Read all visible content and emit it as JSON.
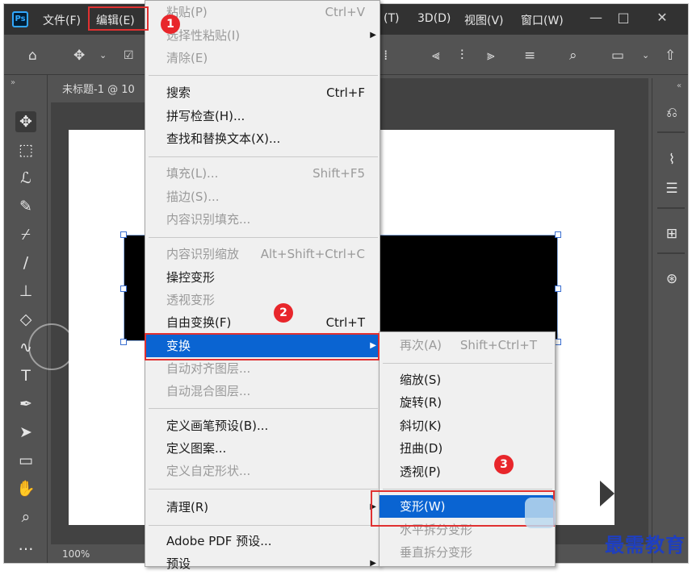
{
  "titlebar": {
    "app_icon": "Ps",
    "menus": [
      {
        "label": "文件(F)"
      },
      {
        "label": "编辑(E)"
      },
      {
        "label": "(T)"
      },
      {
        "label": "3D(D)"
      },
      {
        "label": "视图(V)"
      },
      {
        "label": "窗口(W)"
      }
    ],
    "minimize": "—",
    "maximize": "□",
    "close": "✕"
  },
  "document": {
    "tab_title": "未标题-1 @ 10",
    "zoom": "100%"
  },
  "edit_menu": {
    "items": [
      {
        "label": "粘贴(P)",
        "shortcut": "Ctrl+V",
        "disabled": true
      },
      {
        "label": "选择性粘贴(I)",
        "shortcut": "",
        "disabled": true
      },
      {
        "label": "清除(E)",
        "shortcut": "",
        "disabled": true
      },
      {
        "label": "搜索",
        "shortcut": "Ctrl+F",
        "disabled": false
      },
      {
        "label": "拼写检查(H)...",
        "shortcut": "",
        "disabled": false
      },
      {
        "label": "查找和替换文本(X)...",
        "shortcut": "",
        "disabled": false
      },
      {
        "label": "填充(L)...",
        "shortcut": "Shift+F5",
        "disabled": true
      },
      {
        "label": "描边(S)...",
        "shortcut": "",
        "disabled": true
      },
      {
        "label": "内容识别填充...",
        "shortcut": "",
        "disabled": true
      },
      {
        "label": "内容识别缩放",
        "shortcut": "Alt+Shift+Ctrl+C",
        "disabled": true
      },
      {
        "label": "操控变形",
        "shortcut": "",
        "disabled": false
      },
      {
        "label": "透视变形",
        "shortcut": "",
        "disabled": true
      },
      {
        "label": "自由变换(F)",
        "shortcut": "Ctrl+T",
        "disabled": false
      },
      {
        "label": "变换",
        "shortcut": "",
        "disabled": false
      },
      {
        "label": "自动对齐图层...",
        "shortcut": "",
        "disabled": true
      },
      {
        "label": "自动混合图层...",
        "shortcut": "",
        "disabled": true
      },
      {
        "label": "定义画笔预设(B)...",
        "shortcut": "",
        "disabled": false
      },
      {
        "label": "定义图案...",
        "shortcut": "",
        "disabled": false
      },
      {
        "label": "定义自定形状...",
        "shortcut": "",
        "disabled": true
      },
      {
        "label": "清理(R)",
        "shortcut": "",
        "disabled": false
      },
      {
        "label": "Adobe PDF 预设...",
        "shortcut": "",
        "disabled": false
      },
      {
        "label": "预设",
        "shortcut": "",
        "disabled": false
      }
    ]
  },
  "transform_submenu": {
    "items": [
      {
        "label": "再次(A)",
        "shortcut": "Shift+Ctrl+T",
        "disabled": true
      },
      {
        "label": "缩放(S)",
        "disabled": false
      },
      {
        "label": "旋转(R)",
        "disabled": false
      },
      {
        "label": "斜切(K)",
        "disabled": false
      },
      {
        "label": "扭曲(D)",
        "disabled": false
      },
      {
        "label": "透视(P)",
        "disabled": false
      },
      {
        "label": "变形(W)",
        "disabled": false
      },
      {
        "label": "水平拆分变形",
        "disabled": true
      },
      {
        "label": "垂直拆分变形",
        "disabled": true
      }
    ]
  },
  "annotations": {
    "step1": "1",
    "step2": "2",
    "step3": "3",
    "highlight_color": "#e03131"
  },
  "watermark": "最需教育",
  "colors": {
    "menu_highlight": "#0a64d2",
    "ps_blue": "#31a8ff"
  }
}
